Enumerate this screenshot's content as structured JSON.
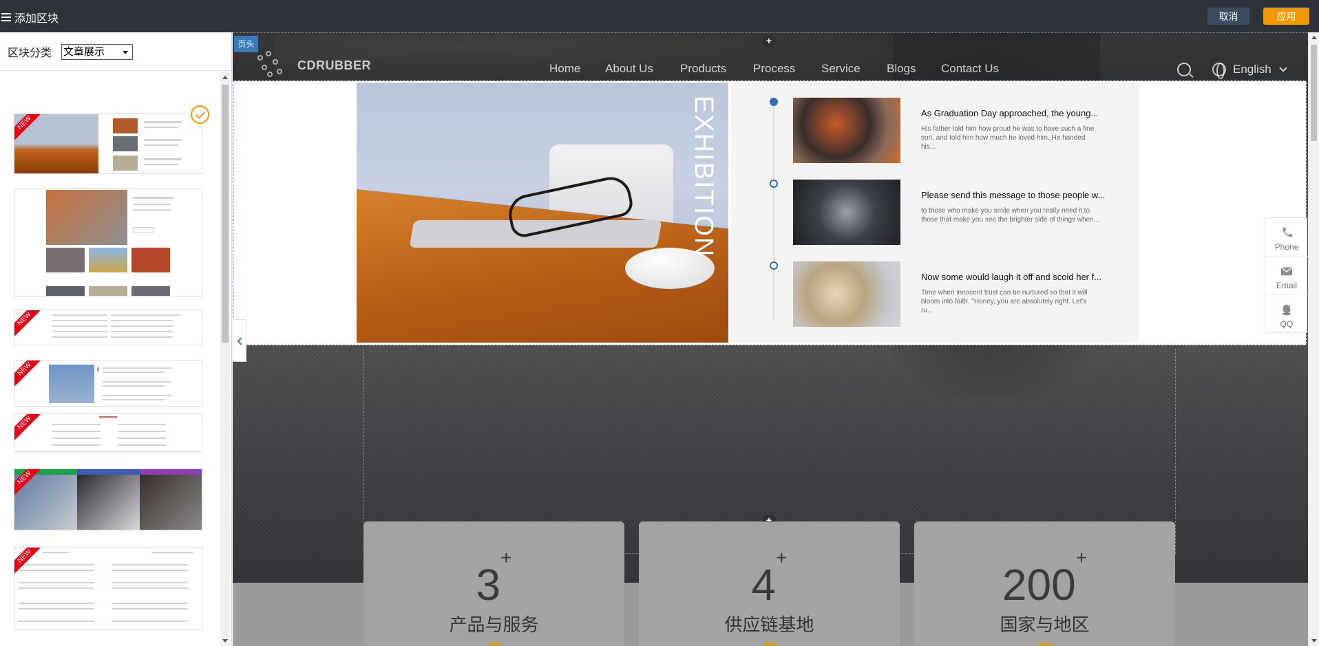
{
  "topbar": {
    "title": "添加区块",
    "cancel_label": "取消",
    "apply_label": "应用",
    "colors": {
      "bg": "#2e3339",
      "apply": "#f39800",
      "cancel": "#3a4d63"
    }
  },
  "sidebar": {
    "filter_label": "区块分类",
    "filter_value": "文章展示",
    "new_badge": "NEW",
    "thumbnails": [
      {
        "name": "exhibition-timeline",
        "new": true,
        "selected": true
      },
      {
        "name": "grid-articles",
        "new": false
      },
      {
        "name": "text-news-list",
        "new": true
      },
      {
        "name": "buildings-news",
        "new": true
      },
      {
        "name": "two-column-list",
        "new": true
      },
      {
        "name": "business-tabs",
        "new": true
      },
      {
        "name": "news-center-list",
        "new": true
      }
    ]
  },
  "preview": {
    "header_tag": "页头",
    "logo_text": "CDRUBBER",
    "nav": [
      "Home",
      "About Us",
      "Products",
      "Process",
      "Service",
      "Blogs",
      "Contact Us"
    ],
    "language": "English",
    "exhibition_word": "EXHIBITION",
    "articles": [
      {
        "title": "As Graduation Day approached, the young...",
        "desc": "His father told him how proud he was to have such a fine son, and told him how much he loved him. He handed his..."
      },
      {
        "title": "Please send this message to those people w...",
        "desc": "to those who make you smile when you really need it,to those that make you see the brighter side of things when..."
      },
      {
        "title": "Now some would laugh it off and scold her f...",
        "desc": "Time when innocent trust can be nurtured so that it will bloom into faith. \"Honey, you are absolutely right. Let's ru..."
      }
    ],
    "contact": [
      {
        "label": "Phone",
        "icon": "phone-icon"
      },
      {
        "label": "Email",
        "icon": "email-icon"
      },
      {
        "label": "QQ",
        "icon": "qq-icon"
      }
    ],
    "stats": [
      {
        "num": "3",
        "sup": "+",
        "label": "产品与服务"
      },
      {
        "num": "4",
        "sup": "+",
        "label": "供应链基地"
      },
      {
        "num": "200",
        "sup": "+",
        "label": "国家与地区"
      }
    ]
  }
}
